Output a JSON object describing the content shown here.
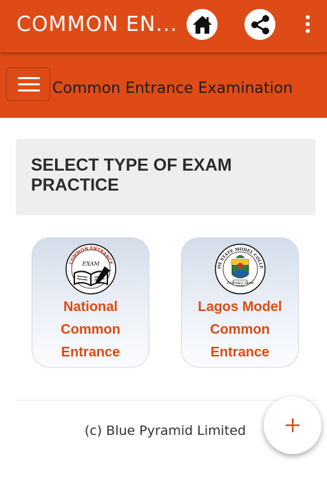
{
  "app_bar": {
    "title": "COMMON EN...",
    "home_icon": "home-icon",
    "share_icon": "share-icon",
    "overflow_icon": "more-vert-icon",
    "color": "#de4b16"
  },
  "nav": {
    "menu_icon": "hamburger-menu-icon",
    "title": "Common Entrance Examination"
  },
  "main": {
    "heading": "SELECT TYPE OF EXAM PRACTICE",
    "cards": [
      {
        "label": "National Common Entrance",
        "logo_text_top": "COMMON ENTRANCE",
        "logo_text_mid": "EXAM",
        "logo_icon": "book-pen-logo-icon"
      },
      {
        "label": "Lagos Model Common Entrance",
        "logo_text_top": "LAGOS STATE MODEL COLLEGES",
        "logo_text_mid": "ENTRANCE EXAM",
        "logo_icon": "lagos-crest-logo-icon"
      }
    ]
  },
  "footer": {
    "text": "(c) Blue Pyramid Limited"
  },
  "fab": {
    "icon": "plus-icon",
    "label": "+"
  }
}
